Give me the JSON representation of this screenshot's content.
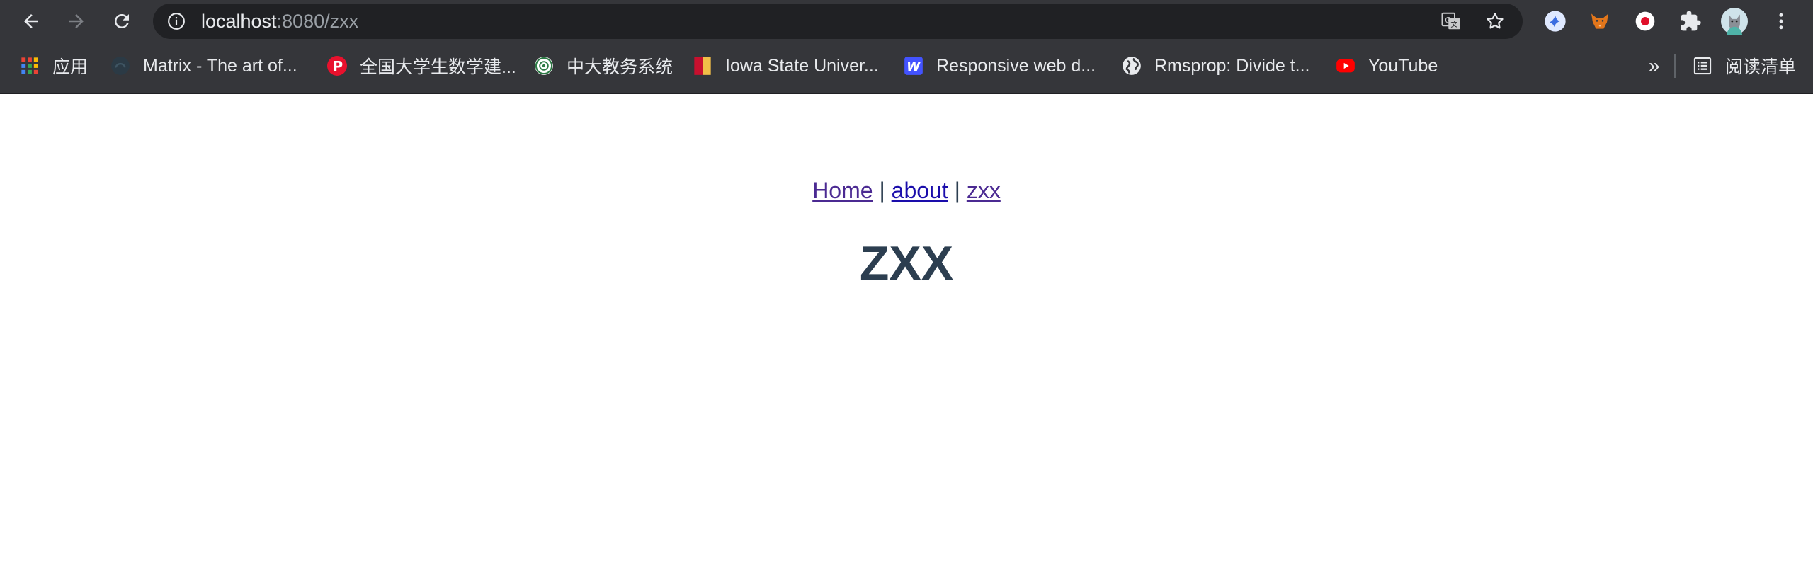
{
  "browser": {
    "url_host": "localhost",
    "url_rest": ":8080/zxx",
    "bookmarks": [
      {
        "label": "应用"
      },
      {
        "label": "Matrix - The art of..."
      },
      {
        "label": "全国大学生数学建..."
      },
      {
        "label": "中大教务系统"
      },
      {
        "label": "Iowa State Univer..."
      },
      {
        "label": "Responsive web d..."
      },
      {
        "label": "Rmsprop: Divide t..."
      },
      {
        "label": "YouTube"
      }
    ],
    "overflow_label": "»",
    "reading_list_label": "阅读清单"
  },
  "page": {
    "nav": {
      "home": "Home",
      "sep1": "|",
      "about": "about",
      "sep2": "|",
      "zxx": "zxx"
    },
    "heading": "ZXX"
  },
  "colors": {
    "chrome_bg": "#35363a",
    "omnibox_bg": "#202124",
    "heading": "#2c3e50",
    "link": "#1a0dab",
    "visited_link": "#4b2a92"
  }
}
